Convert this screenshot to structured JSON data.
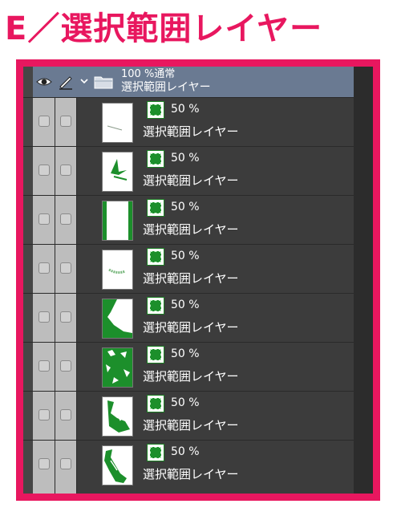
{
  "heading": {
    "text": "E／選択範囲レイヤー",
    "color": "#e8175f"
  },
  "folder": {
    "opacity_blend": "100 %通常",
    "name": "選択範囲レイヤー"
  },
  "layers": [
    {
      "opacity": "50 %",
      "name": "選択範囲レイヤー"
    },
    {
      "opacity": "50 %",
      "name": "選択範囲レイヤー"
    },
    {
      "opacity": "50 %",
      "name": "選択範囲レイヤー"
    },
    {
      "opacity": "50 %",
      "name": "選択範囲レイヤー"
    },
    {
      "opacity": "50 %",
      "name": "選択範囲レイヤー"
    },
    {
      "opacity": "50 %",
      "name": "選択範囲レイヤー"
    },
    {
      "opacity": "50 %",
      "name": "選択範囲レイヤー"
    },
    {
      "opacity": "50 %",
      "name": "選択範囲レイヤー"
    }
  ],
  "colors": {
    "accent": "#e8175f",
    "folder_row": "#6a7a92",
    "panel": "#3c3c3c",
    "mask_green": "#1c8f2b"
  }
}
